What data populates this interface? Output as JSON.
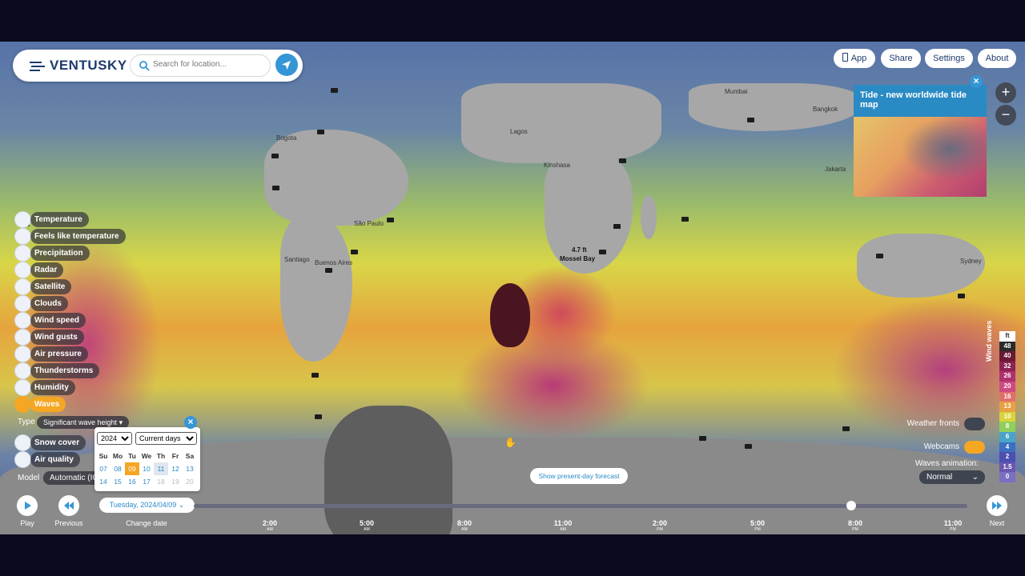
{
  "app": {
    "name": "VENTUSKY"
  },
  "search": {
    "placeholder": "Search for location..."
  },
  "top_menu": [
    {
      "label": "App"
    },
    {
      "label": "Share"
    },
    {
      "label": "Settings"
    },
    {
      "label": "About"
    }
  ],
  "tide_popup": {
    "title": "Tide - new worldwide tide map"
  },
  "map_labels": {
    "mossel_bay_value": "4.7 ft",
    "mossel_bay_name": "Mossel Bay",
    "cities": [
      "Bogota",
      "Lagos",
      "Kinshasa",
      "São Paulo",
      "Santiago",
      "Buenos Aires",
      "Sydney",
      "Mumbai",
      "Bangkok",
      "Jakarta"
    ]
  },
  "layers": [
    {
      "label": "Temperature",
      "icon": "thermometer-icon"
    },
    {
      "label": "Feels like temperature",
      "icon": "person-icon"
    },
    {
      "label": "Precipitation",
      "icon": "drop-icon"
    },
    {
      "label": "Radar",
      "icon": "radar-icon"
    },
    {
      "label": "Satellite",
      "icon": "satellite-icon"
    },
    {
      "label": "Clouds",
      "icon": "cloud-icon"
    },
    {
      "label": "Wind speed",
      "icon": "wind-icon"
    },
    {
      "label": "Wind gusts",
      "icon": "gust-icon"
    },
    {
      "label": "Air pressure",
      "icon": "pressure-icon"
    },
    {
      "label": "Thunderstorms",
      "icon": "lightning-icon"
    },
    {
      "label": "Humidity",
      "icon": "humidity-icon"
    },
    {
      "label": "Waves",
      "icon": "waves-icon",
      "active": true
    }
  ],
  "waves_type": {
    "label": "Type",
    "value": "Significant wave height"
  },
  "extra_layers": [
    {
      "label": "Snow cover",
      "icon": "snowflake-icon"
    },
    {
      "label": "Air quality",
      "icon": "air-quality-icon"
    }
  ],
  "model": {
    "label": "Model",
    "value": "Automatic (IC"
  },
  "calendar": {
    "year": "2024",
    "range": "Current days",
    "weekdays": [
      "Su",
      "Mo",
      "Tu",
      "We",
      "Th",
      "Fr",
      "Sa"
    ],
    "weeks": [
      [
        "07",
        "08",
        "09",
        "10",
        "11",
        "12",
        "13"
      ],
      [
        "14",
        "15",
        "16",
        "17",
        "18",
        "19",
        "20"
      ]
    ],
    "selected": "09",
    "today": "11"
  },
  "timeline": {
    "play_label": "Play",
    "previous_label": "Previous",
    "change_date_label": "Change date",
    "date": "Tuesday, 2024/04/09",
    "next_label": "Next",
    "ticks": [
      {
        "time": "2:00",
        "ampm": "AM"
      },
      {
        "time": "5:00",
        "ampm": "AM"
      },
      {
        "time": "8:00",
        "ampm": "AM"
      },
      {
        "time": "11:00",
        "ampm": "AM"
      },
      {
        "time": "2:00",
        "ampm": "PM"
      },
      {
        "time": "5:00",
        "ampm": "PM"
      },
      {
        "time": "8:00",
        "ampm": "PM"
      },
      {
        "time": "11:00",
        "ampm": "PM"
      }
    ],
    "position_fraction": 0.85
  },
  "present_day": {
    "label": "Show present-day forecast"
  },
  "controls": {
    "weather_fronts": "Weather fronts",
    "webcams": "Webcams",
    "waves_animation": "Waves animation:",
    "animation_value": "Normal"
  },
  "legend": {
    "title": "Wind waves",
    "unit": "ft",
    "values": [
      "48",
      "40",
      "32",
      "26",
      "20",
      "16",
      "13",
      "10",
      "8",
      "6",
      "4",
      "2",
      "1.5",
      "0"
    ],
    "colors": [
      "#2b2b2b",
      "#6a1a35",
      "#8c2356",
      "#b0306e",
      "#d04a82",
      "#e0706b",
      "#e8a043",
      "#d9d43a",
      "#8fcf5b",
      "#4aa3c8",
      "#3b6fc2",
      "#4b4fb0",
      "#6a58b0",
      "#7a70c0"
    ]
  }
}
